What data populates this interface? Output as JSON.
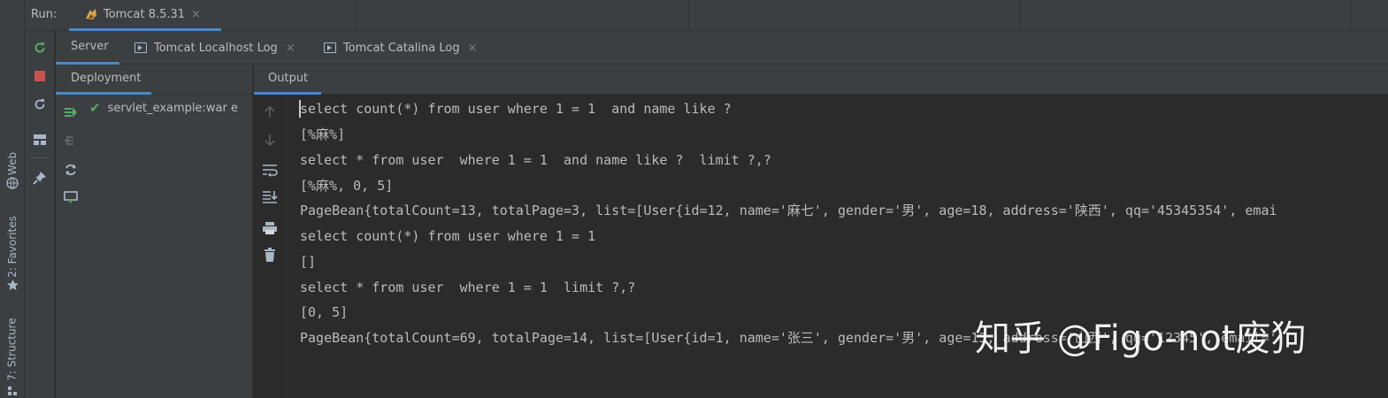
{
  "run_bar": {
    "label": "Run:",
    "tab_title": "Tomcat 8.5.31",
    "close_glyph": "×"
  },
  "left_strip": {
    "tabs": [
      {
        "label": "Web",
        "icon": "globe-icon"
      },
      {
        "label": "2: Favorites",
        "icon": "star-icon"
      },
      {
        "label": "7: Structure",
        "icon": "structure-icon"
      }
    ]
  },
  "run_toolbar": {
    "buttons": [
      "rerun-icon",
      "stop-icon",
      "update-icon",
      "layout-icon",
      "pin-icon"
    ]
  },
  "sub_tabs": [
    {
      "label": "Server",
      "active": true
    },
    {
      "label": "Tomcat Localhost Log",
      "active": false
    },
    {
      "label": "Tomcat Catalina Log",
      "active": false
    }
  ],
  "deployment": {
    "header": "Deployment",
    "items": [
      {
        "label": "servlet_example:war e",
        "status": "deployed"
      }
    ],
    "tools": [
      "deploy-all-icon",
      "undeploy-icon",
      "redeploy-icon",
      "deploy-artifact-icon"
    ]
  },
  "output": {
    "header": "Output",
    "tools": [
      "scroll-up-icon",
      "scroll-down-icon",
      "soft-wrap-icon",
      "scroll-to-end-icon",
      "print-icon",
      "clear-icon"
    ],
    "lines": [
      "select count(*) from user where 1 = 1  and name like ?",
      "[%麻%]",
      "select * from user  where 1 = 1  and name like ?  limit ?,?",
      "[%麻%, 0, 5]",
      "PageBean{totalCount=13, totalPage=3, list=[User{id=12, name='麻七', gender='男', age=18, address='陕西', qq='45345354', emai",
      "select count(*) from user where 1 = 1",
      "[]",
      "select * from user  where 1 = 1  limit ?,?",
      "[0, 5]",
      "PageBean{totalCount=69, totalPage=14, list=[User{id=1, name='张三', gender='男', age=13, address='山西', qq='12345', email='"
    ]
  },
  "watermark": "知乎 @Figo-not废狗",
  "colors": {
    "background": "#2b2b2b",
    "panel": "#3c3f41",
    "accent": "#4a88c7",
    "text": "#bbbbbb",
    "green": "#59a869",
    "red": "#c75450"
  }
}
